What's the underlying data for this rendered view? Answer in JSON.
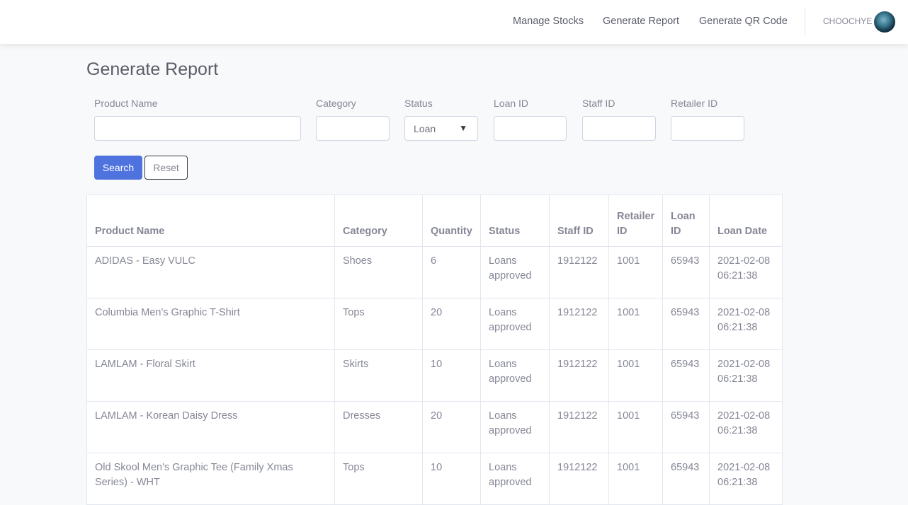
{
  "nav": {
    "items": [
      "Manage Stocks",
      "Generate Report",
      "Generate QR Code"
    ],
    "username": "CHOOCHYE"
  },
  "page": {
    "title": "Generate Report"
  },
  "filters": {
    "product_name_label": "Product Name",
    "category_label": "Category",
    "status_label": "Status",
    "status_value": "Loan",
    "loan_id_label": "Loan ID",
    "staff_id_label": "Staff ID",
    "retailer_id_label": "Retailer ID",
    "search_label": "Search",
    "reset_label": "Reset"
  },
  "table": {
    "headers": [
      "Product Name",
      "Category",
      "Quantity",
      "Status",
      "Staff ID",
      "Retailer ID",
      "Loan ID",
      "Loan Date"
    ],
    "rows": [
      [
        "ADIDAS - Easy VULC",
        "Shoes",
        "6",
        "Loans approved",
        "1912122",
        "1001",
        "65943",
        "2021-02-08 06:21:38"
      ],
      [
        "Columbia Men's Graphic T-Shirt",
        "Tops",
        "20",
        "Loans approved",
        "1912122",
        "1001",
        "65943",
        "2021-02-08 06:21:38"
      ],
      [
        "LAMLAM - Floral Skirt",
        "Skirts",
        "10",
        "Loans approved",
        "1912122",
        "1001",
        "65943",
        "2021-02-08 06:21:38"
      ],
      [
        "LAMLAM - Korean Daisy Dress",
        "Dresses",
        "20",
        "Loans approved",
        "1912122",
        "1001",
        "65943",
        "2021-02-08 06:21:38"
      ],
      [
        "Old Skool Men's Graphic Tee (Family Xmas Series) - WHT",
        "Tops",
        "10",
        "Loans approved",
        "1912122",
        "1001",
        "65943",
        "2021-02-08 06:21:38"
      ]
    ]
  }
}
